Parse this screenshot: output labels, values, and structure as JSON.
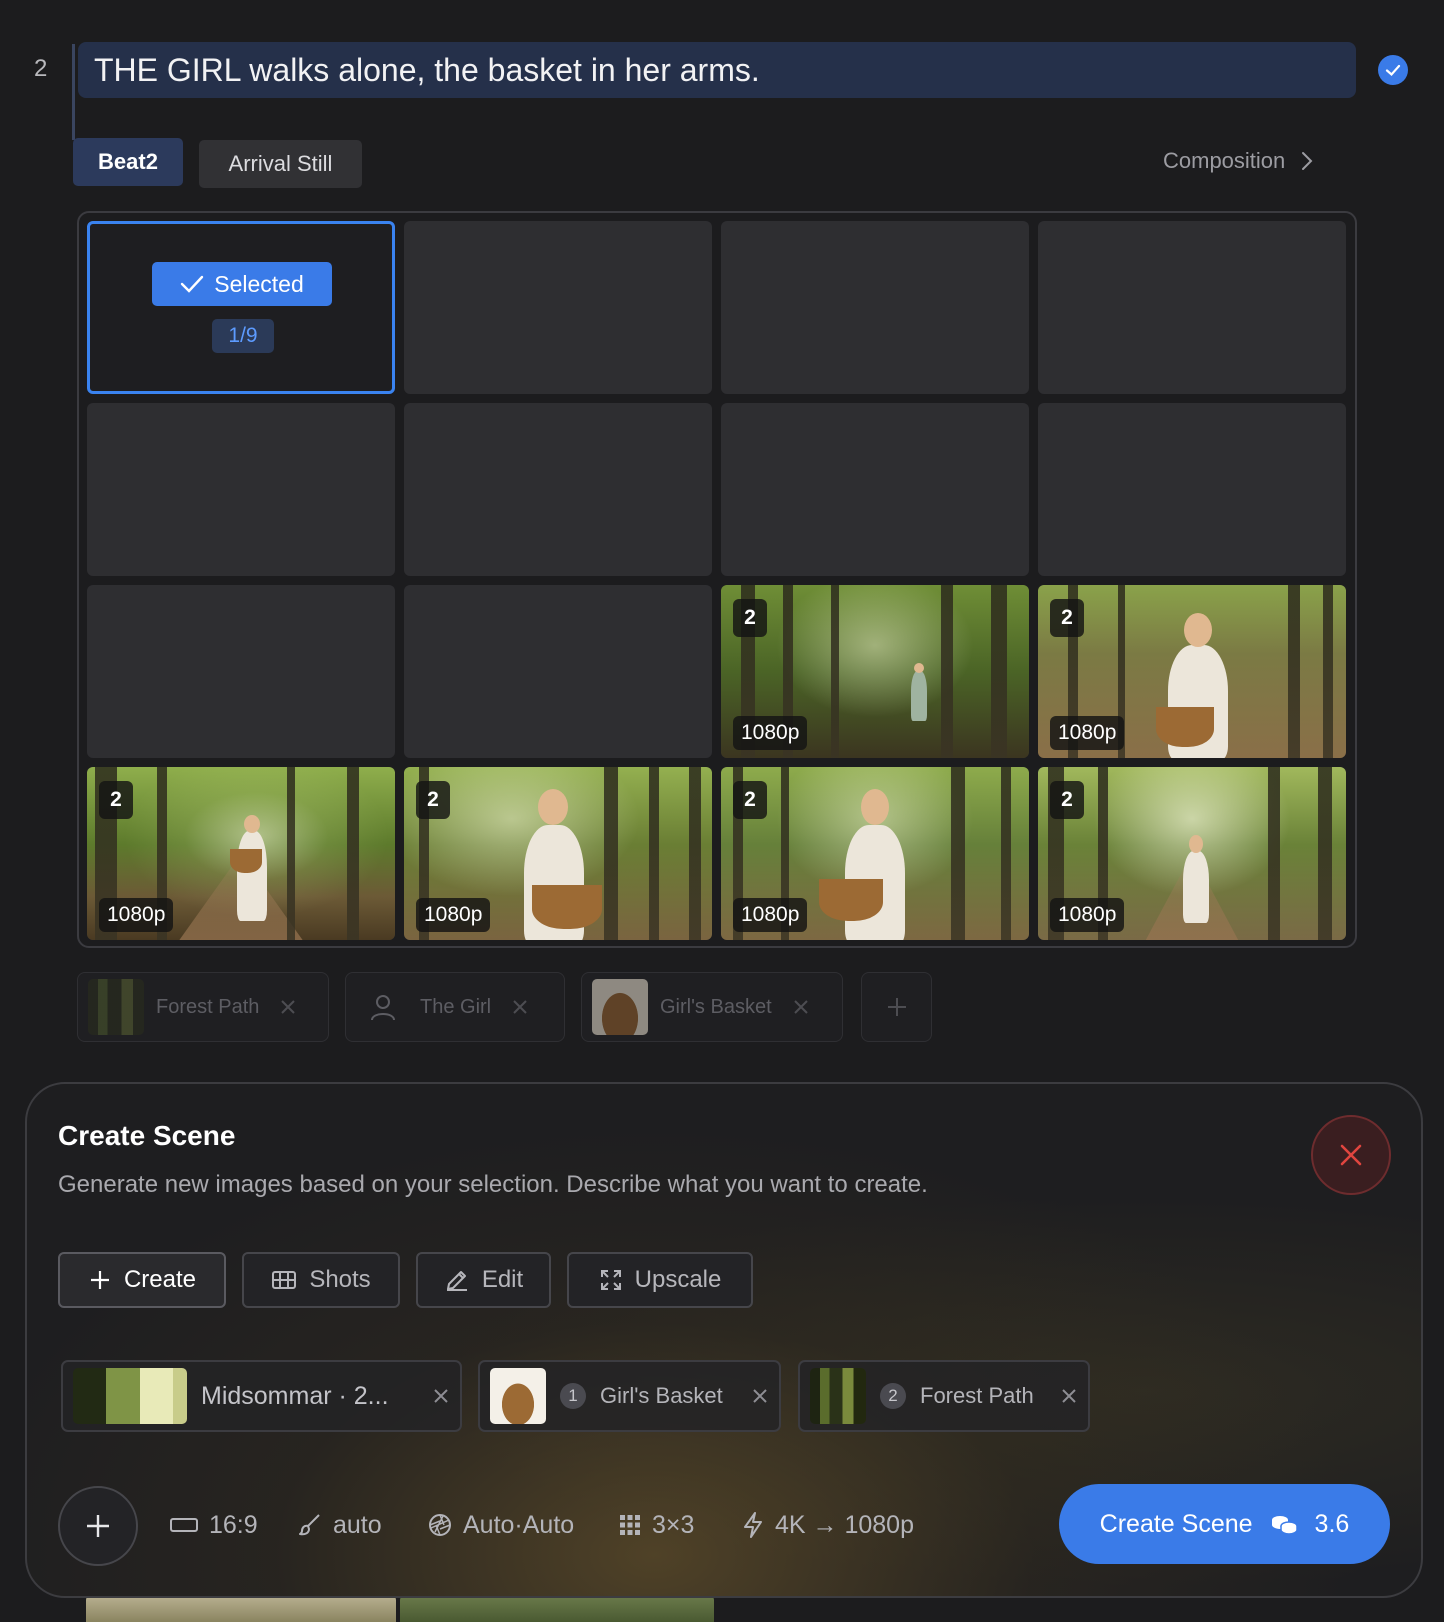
{
  "row": {
    "number": "2",
    "prompt": "THE GIRL walks alone, the basket in her arms.",
    "tags": [
      "Beat2",
      "Arrival Still"
    ],
    "composition_label": "Composition"
  },
  "grid": {
    "selected_label": "Selected",
    "selected_count": "1/9",
    "image_badge": "2",
    "image_resolution": "1080p"
  },
  "assets": [
    {
      "label": "Forest Path"
    },
    {
      "label": "The Girl"
    },
    {
      "label": "Girl's Basket"
    }
  ],
  "panel": {
    "title": "Create Scene",
    "subtitle": "Generate new images based on your selection. Describe what you want to create.",
    "modes": [
      "Create",
      "Shots",
      "Edit",
      "Upscale"
    ],
    "refs": [
      {
        "label": "Midsommar · 2..."
      },
      {
        "index": "1",
        "label": "Girl's Basket"
      },
      {
        "index": "2",
        "label": "Forest Path"
      }
    ],
    "options": {
      "aspect": "16:9",
      "style": "auto",
      "camera": "Auto·Auto",
      "layout": "3×3",
      "resolution": "4K → 1080p"
    },
    "submit_label": "Create Scene",
    "cost": "3.6"
  },
  "colors": {
    "accent": "#3a7be8",
    "background": "#1c1c1e",
    "prompt_bg": "#25304a",
    "close_red": "#e0453f"
  }
}
